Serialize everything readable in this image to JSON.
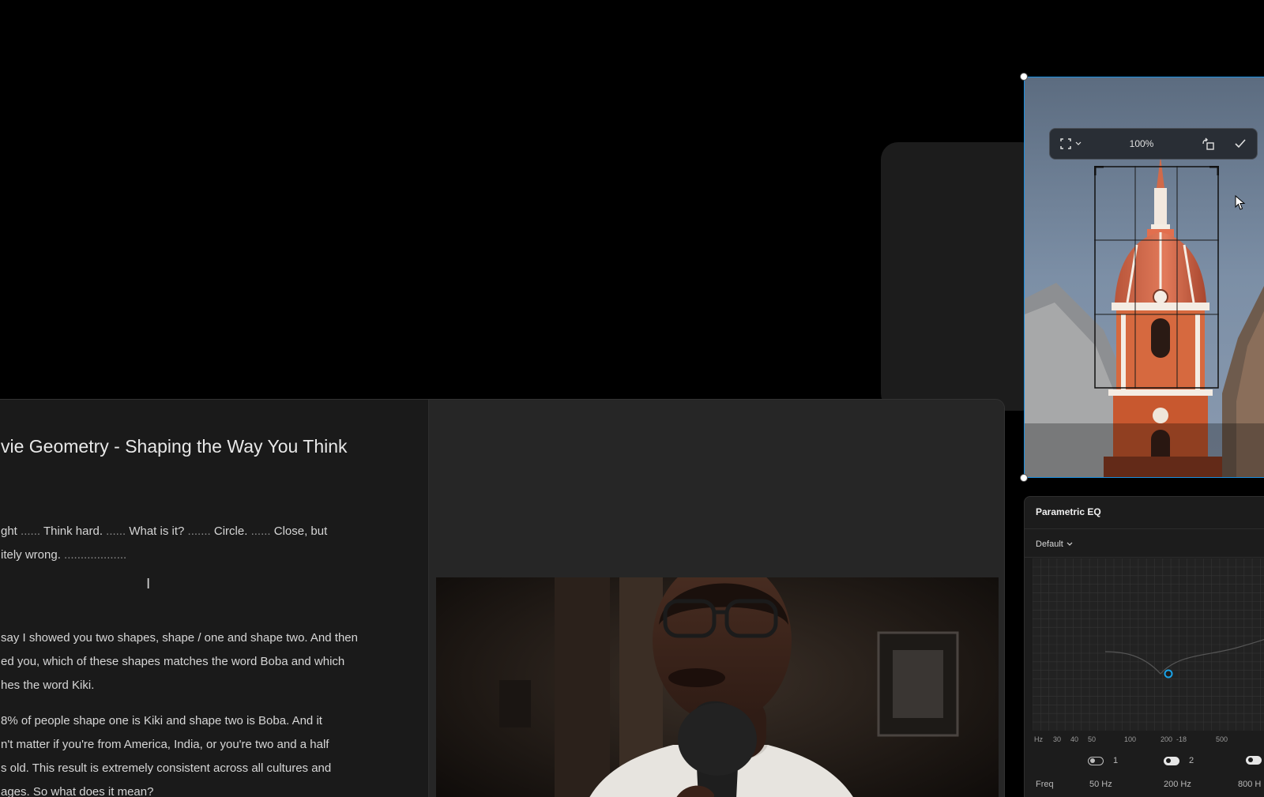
{
  "document": {
    "title": "vie Geometry - Shaping the Way You Think",
    "paragraph1": {
      "runs": [
        {
          "text": "ght ",
          "pause": false
        },
        {
          "text": "......",
          "pause": true
        },
        {
          "text": " Think hard. ",
          "pause": false
        },
        {
          "text": "......",
          "pause": true
        },
        {
          "text": " What is it? ",
          "pause": false
        },
        {
          "text": ".......",
          "pause": true
        },
        {
          "text": " Circle. ",
          "pause": false
        },
        {
          "text": "......",
          "pause": true
        },
        {
          "text": " Close, but",
          "pause": false
        },
        {
          "text": "\nitely wrong. ",
          "pause": false
        },
        {
          "text": "...................",
          "pause": true
        }
      ]
    },
    "paragraph2": "say I showed you two shapes, shape / one and shape two. And then\ned you, which of these shapes matches the word Boba and which\nhes the word Kiki.",
    "paragraph3": "8% of people shape one is Kiki and shape two is Boba. And it\nn't matter if you're from America, India, or you're two and a half\ns old. This result is extremely consistent across all cultures and\nages. So what does it mean?"
  },
  "crop_tool": {
    "aspect_icon": "crop-frame-icon",
    "zoom": "100%",
    "rotate_icon": "rotate-icon",
    "confirm_icon": "check-icon"
  },
  "eq": {
    "title": "Parametric EQ",
    "preset": "Default",
    "axis_labels": [
      "Hz",
      "30",
      "40",
      "50",
      "100",
      "200",
      "-18",
      "500"
    ],
    "bands": [
      {
        "number": "1",
        "enabled": false,
        "freq": "50 Hz"
      },
      {
        "number": "2",
        "enabled": true,
        "freq": "200 Hz"
      },
      {
        "number": "",
        "enabled": true,
        "freq": "800 H"
      }
    ],
    "freq_label": "Freq",
    "accent": "#1aa3e8"
  }
}
